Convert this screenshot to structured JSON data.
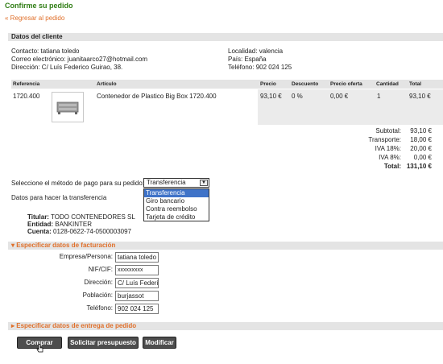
{
  "header": {
    "title": "Confirme su pedido",
    "back_link": "« Regresar al pedido"
  },
  "customer": {
    "section_title": "Datos del cliente",
    "contact": "Contacto: tatiana toledo",
    "email": "Correo electrónico: juanitaarco27@hotmail.com",
    "address": "Dirección: C/ Luís Federico Guirao, 38.",
    "city": "Localidad: valencia",
    "country": "País: España",
    "phone": "Teléfono: 902 024 125"
  },
  "table": {
    "headers": [
      "Referencia",
      "Artículo",
      "Precio",
      "Descuento",
      "Precio oferta",
      "Cantidad",
      "Total"
    ],
    "rows": [
      {
        "ref": "1720.400",
        "article": "Contenedor de Plastico Big Box 1720.400",
        "price": "93,10 €",
        "discount": "0 %",
        "offer_price": "0,00 €",
        "qty": "1",
        "total": "93,10 €"
      }
    ]
  },
  "totals": {
    "subtotal_label": "Subtotal:",
    "subtotal": "93,10 €",
    "transport_label": "Transporte:",
    "transport": "18,00 €",
    "iva18_label": "IVA 18%:",
    "iva18": "20,00 €",
    "iva8_label": "IVA 8%:",
    "iva8": "0,00 €",
    "total_label": "Total:",
    "total": "131,10 €"
  },
  "payment": {
    "prompt": "Seleccione el método de pago para su pedido:",
    "selected": "Transferencia",
    "options": [
      "Transferencia",
      "Giro bancario",
      "Contra reembolso",
      "Tarjeta de crédito"
    ],
    "transfer_info_label": "Datos para hacer la transferencia",
    "holder_label": "Titular:",
    "holder": "TODO CONTENEDORES SL",
    "bank_label": "Entidad:",
    "bank": "BANKINTER",
    "account_label": "Cuenta:",
    "account": "0128-0622-74-0500003097"
  },
  "billing": {
    "section_title": "Especificar datos de facturación",
    "company_label": "Empresa/Persona:",
    "company": "tatiana toledo",
    "nif_label": "NIF/CIF:",
    "nif": "xxxxxxxxx",
    "address_label": "Dirección:",
    "address": "C/ Luís Federico Guira",
    "town_label": "Población:",
    "town": "burjassot",
    "phone_label": "Teléfono:",
    "phone": "902 024 125"
  },
  "delivery": {
    "section_title": "Especificar datos de entrega de pedido"
  },
  "actions": {
    "buy": "Comprar",
    "quote": "Solicitar presupuesto",
    "modify": "Modificar"
  },
  "icons": {
    "triangle_down": "triangle-down-icon",
    "triangle_right": "triangle-right-icon",
    "accent_color": "#e0702b",
    "title_color": "#2f7d14"
  }
}
